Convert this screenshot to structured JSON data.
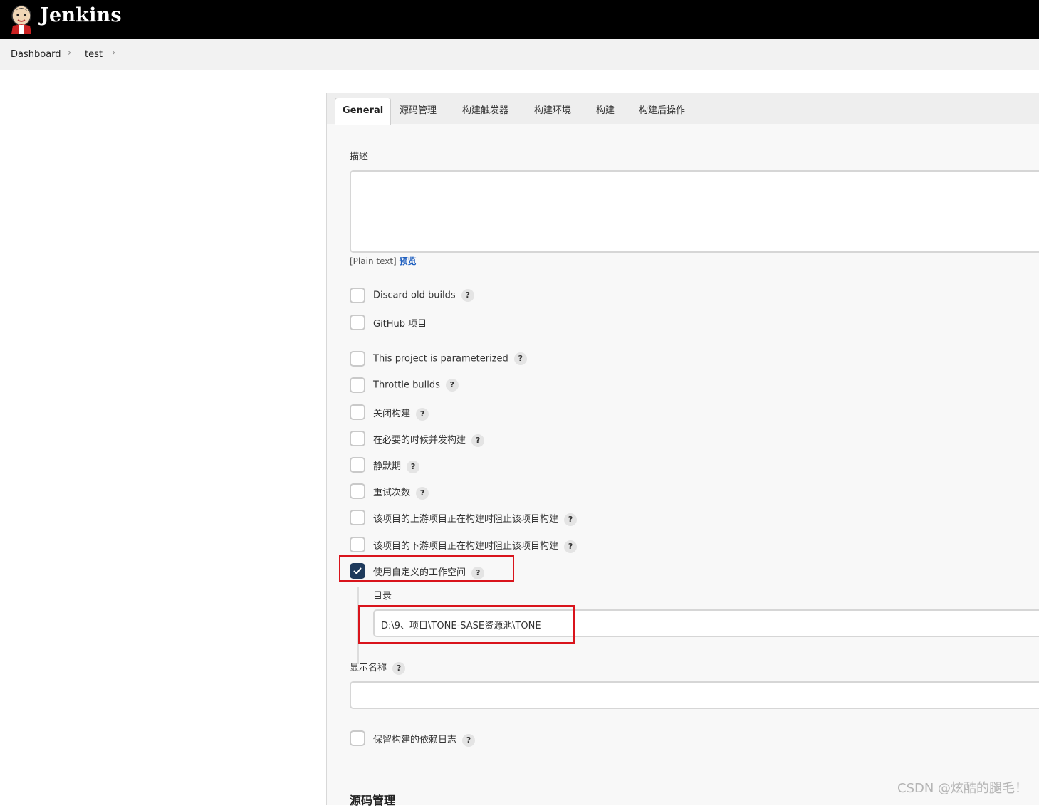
{
  "header": {
    "app_name": "Jenkins",
    "logo_icon": "jenkins-butler-logo"
  },
  "breadcrumb": {
    "items": [
      "Dashboard",
      "test"
    ]
  },
  "tabs": [
    "General",
    "源码管理",
    "构建触发器",
    "构建环境",
    "构建",
    "构建后操作"
  ],
  "active_tab": "General",
  "description": {
    "label": "描述",
    "value": "",
    "format_hint": "[Plain text]",
    "preview_link": "预览"
  },
  "options": [
    {
      "label": "Discard old builds",
      "checked": false,
      "help": "?"
    },
    {
      "label": "GitHub 项目",
      "checked": false,
      "help": ""
    },
    {
      "label": "This project is parameterized",
      "checked": false,
      "help": "?"
    },
    {
      "label": "Throttle builds",
      "checked": false,
      "help": "?"
    },
    {
      "label": "关闭构建",
      "checked": false,
      "help": "?"
    },
    {
      "label": "在必要的时候并发构建",
      "checked": false,
      "help": "?"
    },
    {
      "label": "静默期",
      "checked": false,
      "help": "?"
    },
    {
      "label": "重试次数",
      "checked": false,
      "help": "?"
    },
    {
      "label": "该项目的上游项目正在构建时阻止该项目构建",
      "checked": false,
      "help": "?"
    },
    {
      "label": "该项目的下游项目正在构建时阻止该项目构建",
      "checked": false,
      "help": "?"
    },
    {
      "label": "使用自定义的工作空间",
      "checked": true,
      "help": "?"
    }
  ],
  "custom_workspace": {
    "directory_label": "目录",
    "directory_value": "D:\\9、项目\\TONE-SASE资源池\\TONE"
  },
  "display_name": {
    "label": "显示名称",
    "help": "?",
    "value": ""
  },
  "keep_dependencies": {
    "label": "保留构建的依赖日志",
    "checked": false,
    "help": "?"
  },
  "next_section": {
    "title": "源码管理"
  },
  "highlight_color": "#d9141c",
  "checkbox_checked_color": "#1e3a5c",
  "watermark": "CSDN @炫酷的腿毛！"
}
